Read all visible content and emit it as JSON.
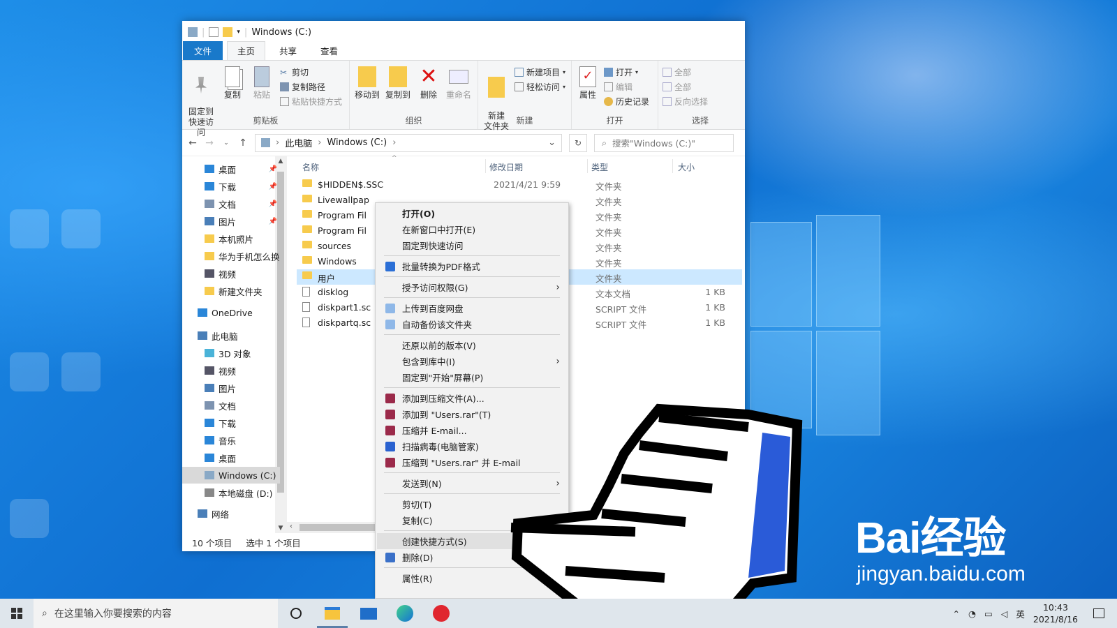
{
  "window": {
    "title": "Windows (C:)",
    "tabs": [
      "文件",
      "主页",
      "共享",
      "查看"
    ]
  },
  "ribbon": {
    "clipboard": {
      "pin": "固定到\n快速访问",
      "copy": "复制",
      "paste": "粘贴",
      "cut": "剪切",
      "copy_path": "复制路径",
      "paste_shortcut": "粘贴快捷方式",
      "label": "剪贴板"
    },
    "organize": {
      "move_to": "移动到",
      "copy_to": "复制到",
      "delete": "删除",
      "rename": "重命名",
      "label": "组织"
    },
    "new": {
      "new_folder": "新建\n文件夹",
      "new_item": "新建项目",
      "easy_access": "轻松访问",
      "label": "新建"
    },
    "open": {
      "properties": "属性",
      "open": "打开",
      "edit": "编辑",
      "history": "历史记录",
      "label": "打开"
    },
    "select": {
      "all": "全部",
      "none": "全部",
      "invert": "反向选择",
      "label": "选择"
    }
  },
  "address": {
    "crumbs": [
      "此电脑",
      "Windows (C:)"
    ],
    "search_placeholder": "搜索\"Windows (C:)\""
  },
  "nav": {
    "items": [
      {
        "label": "桌面",
        "pinned": true
      },
      {
        "label": "下载",
        "pinned": true
      },
      {
        "label": "文档",
        "pinned": true
      },
      {
        "label": "图片",
        "pinned": true
      },
      {
        "label": "本机照片"
      },
      {
        "label": "华为手机怎么换"
      },
      {
        "label": "视频"
      },
      {
        "label": "新建文件夹"
      },
      {
        "label": "OneDrive"
      },
      {
        "label": "此电脑"
      },
      {
        "label": "3D 对象"
      },
      {
        "label": "视频"
      },
      {
        "label": "图片"
      },
      {
        "label": "文档"
      },
      {
        "label": "下载"
      },
      {
        "label": "音乐"
      },
      {
        "label": "桌面"
      },
      {
        "label": "Windows (C:)",
        "selected": true
      },
      {
        "label": "本地磁盘 (D:)"
      },
      {
        "label": "网络"
      }
    ]
  },
  "files": {
    "columns": [
      "名称",
      "修改日期",
      "类型",
      "大小"
    ],
    "rows": [
      {
        "name": "$HIDDEN$.SSC",
        "date": "2021/4/21 9:59",
        "type": "文件夹",
        "size": "",
        "kind": "folder"
      },
      {
        "name": "Livewallpap",
        "date": "",
        "type": "文件夹",
        "size": "",
        "kind": "folder"
      },
      {
        "name": "Program Fil",
        "date": "",
        "type": "文件夹",
        "size": "",
        "kind": "folder"
      },
      {
        "name": "Program Fil",
        "date": "",
        "type": "文件夹",
        "size": "",
        "kind": "folder"
      },
      {
        "name": "sources",
        "date": "",
        "type": "文件夹",
        "size": "",
        "kind": "folder"
      },
      {
        "name": "Windows",
        "date": "",
        "type": "文件夹",
        "size": "",
        "kind": "folder"
      },
      {
        "name": "用户",
        "date": "",
        "type": "文件夹",
        "size": "",
        "kind": "folder",
        "selected": true
      },
      {
        "name": "disklog",
        "date": "",
        "type": "文本文档",
        "size": "1 KB",
        "kind": "doc"
      },
      {
        "name": "diskpart1.sc",
        "date": "",
        "type": "SCRIPT 文件",
        "size": "1 KB",
        "kind": "doc"
      },
      {
        "name": "diskpartq.sc",
        "date": "",
        "type": "SCRIPT 文件",
        "size": "1 KB",
        "kind": "doc"
      }
    ]
  },
  "status": {
    "count": "10 个项目",
    "selected": "选中 1 个项目"
  },
  "context_menu": {
    "items": [
      {
        "label": "打开(O)",
        "bold": true
      },
      {
        "label": "在新窗口中打开(E)"
      },
      {
        "label": "固定到快速访问"
      },
      {
        "sep": true
      },
      {
        "label": "批量转换为PDF格式",
        "icon": "#2b6fd6"
      },
      {
        "sep": true
      },
      {
        "label": "授予访问权限(G)",
        "sub": true
      },
      {
        "sep": true
      },
      {
        "label": "上传到百度网盘",
        "icon": "#8fb8e8"
      },
      {
        "label": "自动备份该文件夹",
        "icon": "#8fb8e8"
      },
      {
        "sep": true
      },
      {
        "label": "还原以前的版本(V)"
      },
      {
        "label": "包含到库中(I)",
        "sub": true
      },
      {
        "label": "固定到\"开始\"屏幕(P)"
      },
      {
        "sep": true
      },
      {
        "label": "添加到压缩文件(A)...",
        "icon": "#9b2a4a"
      },
      {
        "label": "添加到 \"Users.rar\"(T)",
        "icon": "#9b2a4a"
      },
      {
        "label": "压缩并 E-mail...",
        "icon": "#9b2a4a"
      },
      {
        "label": "扫描病毒(电脑管家)",
        "icon": "#2a62d0"
      },
      {
        "label": "压缩到 \"Users.rar\" 并 E-mail",
        "icon": "#9b2a4a"
      },
      {
        "sep": true
      },
      {
        "label": "发送到(N)",
        "sub": true
      },
      {
        "sep": true
      },
      {
        "label": "剪切(T)"
      },
      {
        "label": "复制(C)"
      },
      {
        "sep": true
      },
      {
        "label": "创建快捷方式(S)",
        "highlight": true
      },
      {
        "label": "删除(D)",
        "icon": "#3a70c8"
      },
      {
        "sep": true
      },
      {
        "label": "属性(R)"
      }
    ]
  },
  "taskbar": {
    "search_placeholder": "在这里输入你要搜索的内容",
    "ime": "英",
    "time": "10:43",
    "date": "2021/8/16"
  },
  "watermark": {
    "logo": "Bai经验",
    "url": "jingyan.baidu.com"
  },
  "colors": {
    "accent": "#1979ca",
    "selection": "#cce8ff",
    "folder": "#f7cb4d"
  }
}
